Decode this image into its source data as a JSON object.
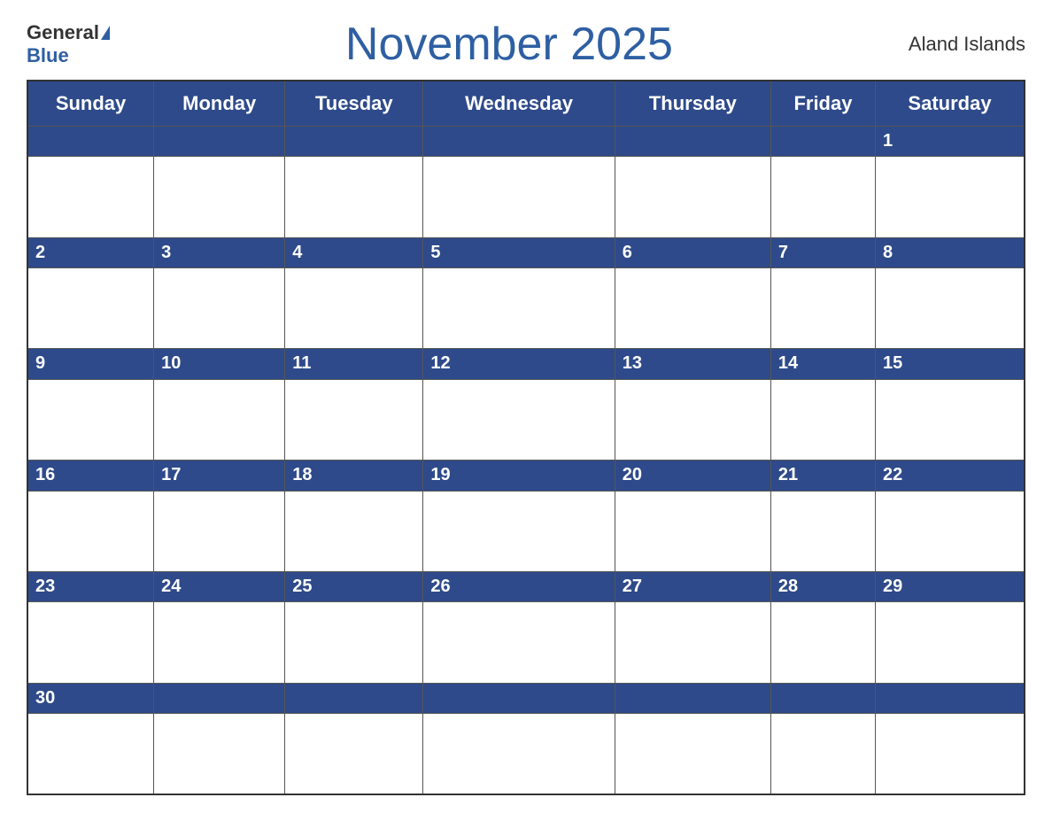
{
  "header": {
    "logo": {
      "general": "General",
      "blue": "Blue",
      "triangle": "▲"
    },
    "title": "November 2025",
    "region": "Aland Islands"
  },
  "calendar": {
    "days": [
      "Sunday",
      "Monday",
      "Tuesday",
      "Wednesday",
      "Thursday",
      "Friday",
      "Saturday"
    ],
    "weeks": [
      [
        "",
        "",
        "",
        "",
        "",
        "",
        "1"
      ],
      [
        "2",
        "3",
        "4",
        "5",
        "6",
        "7",
        "8"
      ],
      [
        "9",
        "10",
        "11",
        "12",
        "13",
        "14",
        "15"
      ],
      [
        "16",
        "17",
        "18",
        "19",
        "20",
        "21",
        "22"
      ],
      [
        "23",
        "24",
        "25",
        "26",
        "27",
        "28",
        "29"
      ],
      [
        "30",
        "",
        "",
        "",
        "",
        "",
        ""
      ]
    ]
  }
}
